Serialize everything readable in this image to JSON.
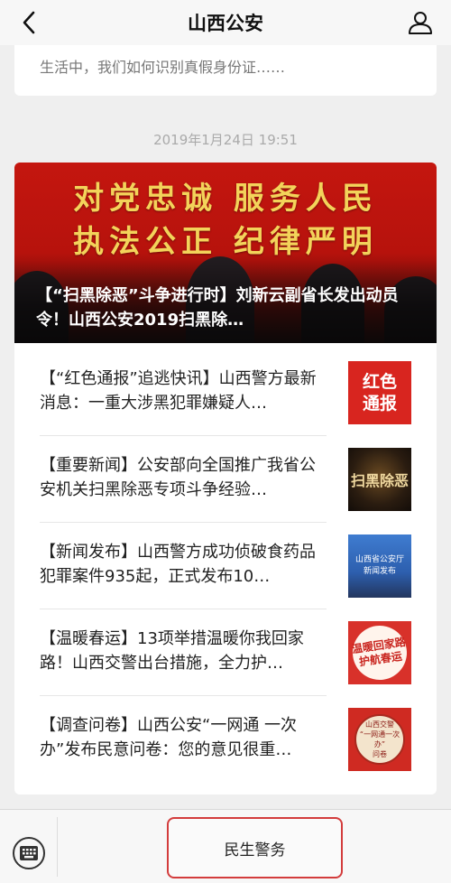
{
  "nav": {
    "title": "山西公安"
  },
  "previous": {
    "summary": "生活中，我们如何识别真假身份证……"
  },
  "timestamp": "2019年1月24日 19:51",
  "hero": {
    "banner_line_1": "对党忠诚  服务人民",
    "banner_line_2": "执法公正  纪律严明",
    "title": "【“扫黑除恶”斗争进行时】刘新云副省长发出动员令！山西公安2019扫黑除…"
  },
  "articles": [
    {
      "title": "【“红色通报”追逃快讯】山西警方最新消息：一重大涉黑犯罪嫌疑人…",
      "thumb_lines": [
        "红色",
        "通报"
      ]
    },
    {
      "title": "【重要新闻】公安部向全国推广我省公安机关扫黑除恶专项斗争经验…",
      "thumb_text": "扫黑除恶"
    },
    {
      "title": "【新闻发布】山西警方成功侦破食药品犯罪案件935起，正式发布10…",
      "thumb_lines": [
        "山西省公安厅",
        "新闻发布"
      ]
    },
    {
      "title": "【温暖春运】13项举措温暖你我回家路！山西交警出台措施，全力护…",
      "thumb_lines": [
        "温暖回家路",
        "护航春运"
      ]
    },
    {
      "title": "【调查问卷】山西公安“一网通 一次办”发布民意问卷：您的意见很重…",
      "thumb_lines": [
        "山西交警",
        "“一网通一次办”",
        "问卷"
      ]
    }
  ],
  "bottom_bar": {
    "menu_label": "民生警务"
  },
  "colors": {
    "accent_red": "#d33c3c",
    "banner_gold": "#f3d35a"
  },
  "icons": {
    "back": "chevron-left-icon",
    "user": "user-icon",
    "keyboard": "keyboard-icon"
  }
}
